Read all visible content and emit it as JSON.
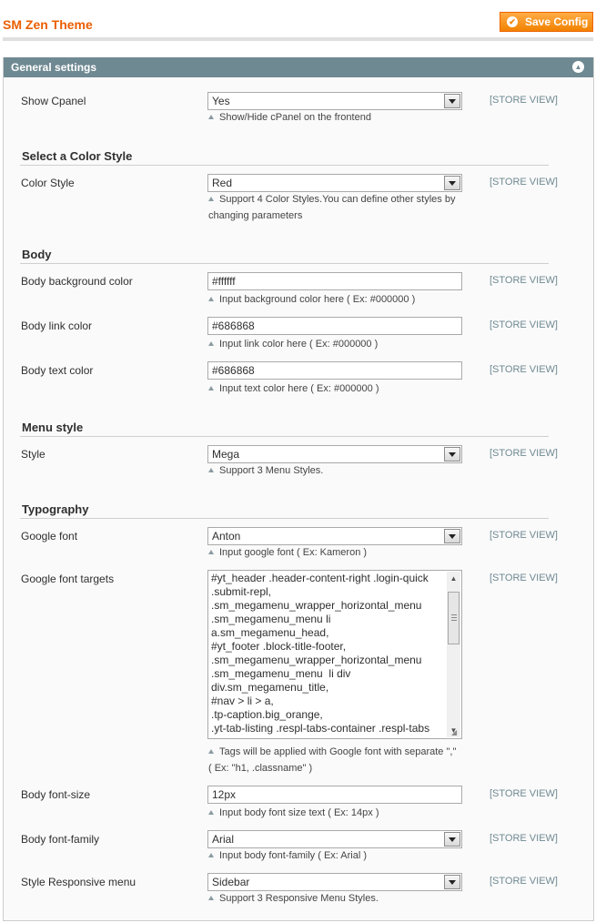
{
  "page": {
    "title": "SM Zen Theme",
    "save_label": "Save Config"
  },
  "section": {
    "title": "General settings"
  },
  "scope_label": "[STORE VIEW]",
  "rows": {
    "show_cpanel": {
      "label": "Show Cpanel",
      "value": "Yes",
      "note": "Show/Hide cPanel on the frontend"
    },
    "color_style": {
      "label": "Color Style",
      "value": "Red",
      "note_line1": "Support 4 Color Styles.You can define other styles by",
      "note_line2": "changing parameters"
    },
    "body_bg": {
      "label": "Body background color",
      "value": "#ffffff",
      "note": "Input background color here ( Ex: #000000 )"
    },
    "body_link": {
      "label": "Body link color",
      "value": "#686868",
      "note": "Input link color here ( Ex: #000000 )"
    },
    "body_text": {
      "label": "Body text color",
      "value": "#686868",
      "note": "Input text color here ( Ex: #000000 )"
    },
    "menu_style": {
      "label": "Style",
      "value": "Mega",
      "note": "Support 3 Menu Styles."
    },
    "google_font": {
      "label": "Google font",
      "value": "Anton",
      "note": "Input google font ( Ex: Kameron )"
    },
    "google_font_targets": {
      "label": "Google font targets",
      "value": "#yt_header .header-content-right .login-quick\n.submit-repl,\n.sm_megamenu_wrapper_horizontal_menu\n.sm_megamenu_menu li\na.sm_megamenu_head,\n#yt_footer .block-title-footer,\n.sm_megamenu_wrapper_horizontal_menu\n.sm_megamenu_menu  li div\ndiv.sm_megamenu_title,\n#nav > li > a,\n.tp-caption.big_orange,\n.yt-tab-listing .respl-tabs-container .respl-tabs",
      "note_line1": "Tags will be applied with Google font with separate \",\"",
      "note_line2": "( Ex: \"h1, .classname\" )"
    },
    "body_font_size": {
      "label": "Body font-size",
      "value": "12px",
      "note": "Input body font size text ( Ex: 14px )"
    },
    "body_font_family": {
      "label": "Body font-family",
      "value": "Arial",
      "note": "Input body font-family ( Ex: Arial )"
    },
    "responsive_menu": {
      "label": "Style Responsive menu",
      "value": "Sidebar",
      "note": "Support 3 Responsive Menu Styles."
    }
  },
  "groups": {
    "color": "Select a Color Style",
    "body": "Body",
    "menu": "Menu style",
    "typography": "Typography"
  },
  "icons": {
    "save": "check-circle-icon",
    "collapse": "chevron-up-circle-icon",
    "note": "triangle-hint-icon",
    "select": "dropdown-arrow-icon"
  },
  "colors": {
    "title": "#eb5e00",
    "button": "#f18200",
    "section_header": "#6f8992",
    "scope": "#6f8992"
  }
}
